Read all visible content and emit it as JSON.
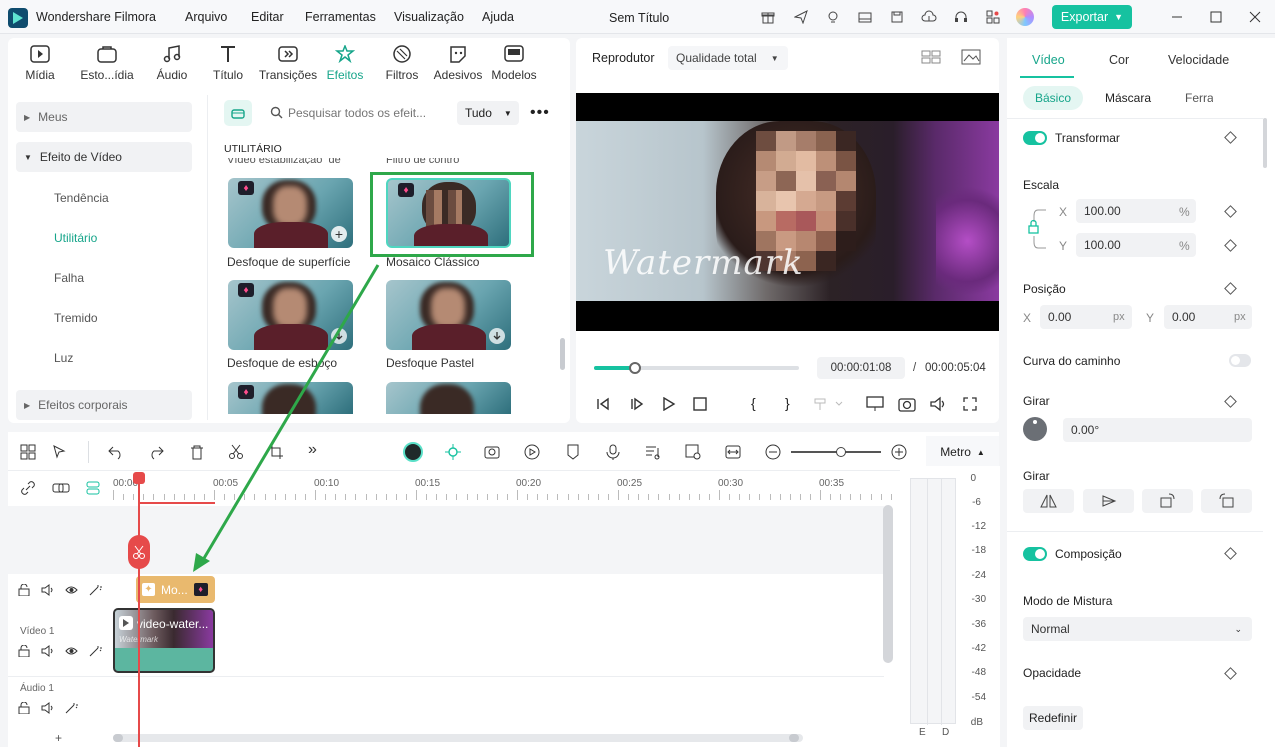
{
  "app": {
    "title": "Wondershare Filmora",
    "document": "Sem Título"
  },
  "menu": [
    "Arquivo",
    "Editar",
    "Ferramentas",
    "Visualização",
    "Ajuda"
  ],
  "export_label": "Exportar",
  "library": {
    "tabs": [
      {
        "label": "Mídia",
        "icon": "media-icon"
      },
      {
        "label": "Esto...ídia",
        "icon": "stock-media-icon"
      },
      {
        "label": "Áudio",
        "icon": "audio-icon"
      },
      {
        "label": "Título",
        "icon": "title-icon"
      },
      {
        "label": "Transições",
        "icon": "transitions-icon"
      },
      {
        "label": "Efeitos",
        "icon": "effects-icon",
        "active": true
      },
      {
        "label": "Filtros",
        "icon": "filters-icon"
      },
      {
        "label": "Adesivos",
        "icon": "stickers-icon"
      },
      {
        "label": "Modelos",
        "icon": "templates-icon"
      }
    ],
    "sidebar": {
      "mine": "Meus",
      "video_effects": "Efeito de Vídeo",
      "items": [
        "Tendência",
        "Utilitário",
        "Falha",
        "Tremido",
        "Luz"
      ],
      "body_effects": "Efeitos corporais"
    },
    "search_placeholder": "Pesquisar todos os efeit...",
    "filter_value": "Tudo",
    "section": "UTILITÁRIO",
    "cut_top_labels": [
      "Vídeo estabilização_de",
      "Filtro de contro"
    ],
    "effects": [
      "Desfoque de superfície",
      "Mosaico Clássico",
      "Desfoque de esboço",
      "Desfoque Pastel"
    ]
  },
  "player": {
    "label": "Reprodutor",
    "quality": "Qualidade total",
    "watermark": "Watermark",
    "current_time": "00:00:01:08",
    "total_time": "00:00:05:04",
    "progress": 0.2
  },
  "timeline": {
    "ruler": [
      "00:00",
      "00:05",
      "00:10",
      "00:15",
      "00:20",
      "00:25",
      "00:30",
      "00:35"
    ],
    "meter_label": "Metro",
    "db": [
      "0",
      "-6",
      "-12",
      "-18",
      "-24",
      "-30",
      "-36",
      "-42",
      "-48",
      "-54",
      "dB"
    ],
    "channels": [
      "E",
      "D"
    ],
    "effect_clip": "Mo...",
    "video_clip": "video-water...",
    "video_clip_sub": "Watermark",
    "tracks": {
      "video": "Vídeo 1",
      "audio": "Áudio 1"
    },
    "zoom": 0.55
  },
  "properties": {
    "tabs": [
      "Vídeo",
      "Cor",
      "Velocidade"
    ],
    "subtabs": [
      "Básico",
      "Máscara",
      "Ferra"
    ],
    "transform": "Transformar",
    "scale": "Escala",
    "scale_x": "100.00",
    "scale_y": "100.00",
    "percent": "%",
    "position": "Posição",
    "pos_x": "0.00",
    "pos_y": "0.00",
    "px": "px",
    "x": "X",
    "y": "Y",
    "path_curve": "Curva do caminho",
    "rotate": "Girar",
    "rotate_value": "0.00°",
    "flip": "Girar",
    "composition": "Composição",
    "blend_mode": "Modo de Mistura",
    "blend_value": "Normal",
    "opacity": "Opacidade",
    "reset": "Redefinir"
  },
  "colors": {
    "accent": "#16c2a0",
    "annotation": "#2ea84a",
    "playhead": "#e64a4a",
    "clip_effect": "#e9b96e",
    "clip_video": "#5cb6a0"
  }
}
